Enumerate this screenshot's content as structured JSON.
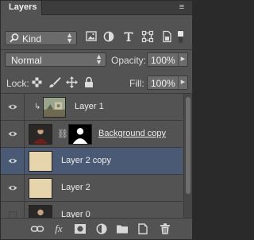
{
  "panel": {
    "tab_label": "Layers",
    "menu_icon": "panel-menu-icon"
  },
  "filter": {
    "kind_label": "Kind"
  },
  "blend": {
    "mode": "Normal",
    "opacity_label": "Opacity:",
    "opacity_value": "100%"
  },
  "lock": {
    "label": "Lock:",
    "fill_label": "Fill:",
    "fill_value": "100%"
  },
  "layers": [
    {
      "name": "Layer 1"
    },
    {
      "name": "Background copy"
    },
    {
      "name": "Layer 2 copy"
    },
    {
      "name": "Layer 2"
    },
    {
      "name": "Layer 0"
    }
  ],
  "footer": {
    "fx_label": "fx"
  },
  "colors": {
    "selected_row": "#4b5a74",
    "panel_bg": "#535353",
    "swatch": "#e6d4ad"
  }
}
